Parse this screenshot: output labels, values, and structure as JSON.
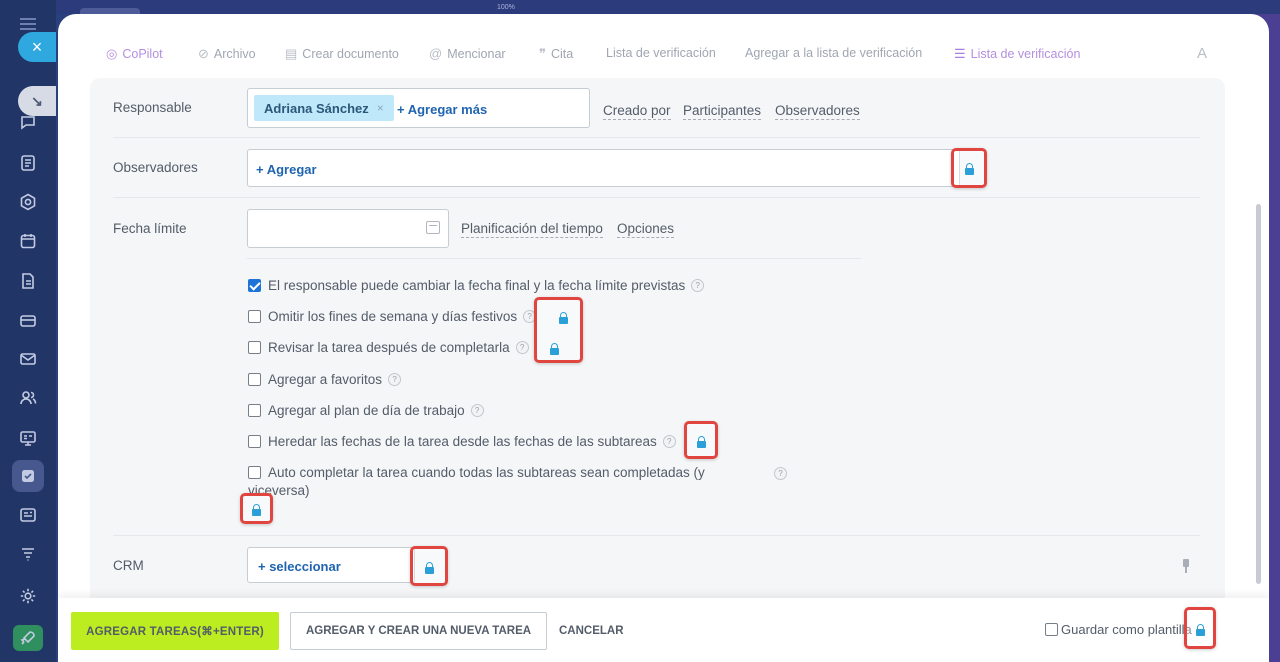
{
  "window": {
    "zoom_label": "100%"
  },
  "toolbar": {
    "items": [
      {
        "label": "CoPilot",
        "icon": "copilot-icon"
      },
      {
        "label": "Archivo",
        "icon": "paperclip-icon"
      },
      {
        "label": "Crear documento",
        "icon": "document-icon"
      },
      {
        "label": "Mencionar",
        "icon": "at-icon"
      },
      {
        "label": "Cita",
        "icon": "quote-icon"
      },
      {
        "label": "Lista de verificación"
      },
      {
        "label": "Agregar a la lista de verificación"
      },
      {
        "label": "Lista de verificación",
        "icon": "checklist-add-icon"
      }
    ],
    "font_label": "A"
  },
  "form": {
    "responsable": {
      "label": "Responsable",
      "chip": "Adriana Sánchez",
      "add_more": "+ Agregar más",
      "links": [
        "Creado por",
        "Participantes",
        "Observadores"
      ]
    },
    "observadores": {
      "label": "Observadores",
      "add": "+ Agregar"
    },
    "fecha_limite": {
      "label": "Fecha límite",
      "date_value": "",
      "links": [
        "Planificación del tiempo",
        "Opciones"
      ]
    },
    "options": [
      {
        "label": "El responsable puede cambiar la fecha final y la fecha límite previstas",
        "checked": true
      },
      {
        "label": "Omitir los fines de semana y días festivos",
        "checked": false
      },
      {
        "label": "Revisar la tarea después de completarla",
        "checked": false
      },
      {
        "label": "Agregar a favoritos",
        "checked": false
      },
      {
        "label": "Agregar al plan de día de trabajo",
        "checked": false
      },
      {
        "label": "Heredar las fechas de la tarea desde las fechas de las subtareas",
        "checked": false
      },
      {
        "label": "Auto completar la tarea cuando todas las subtareas sean completadas (y",
        "label_cont": "viceversa)",
        "checked": false
      }
    ],
    "help_glyph": "?",
    "crm": {
      "label": "CRM",
      "select": "+ seleccionar"
    }
  },
  "footer": {
    "primary": "AGREGAR TAREAS(⌘+ENTER)",
    "secondary": "AGREGAR Y CREAR UNA NUEVA TAREA",
    "cancel": "CANCELAR",
    "save_template": "Guardar como plantilla"
  },
  "colors": {
    "accent_green": "#bbed21",
    "lock_highlight": "#e0463f",
    "lock_icon": "#2a9fd8",
    "link_blue": "#1f64b0"
  }
}
